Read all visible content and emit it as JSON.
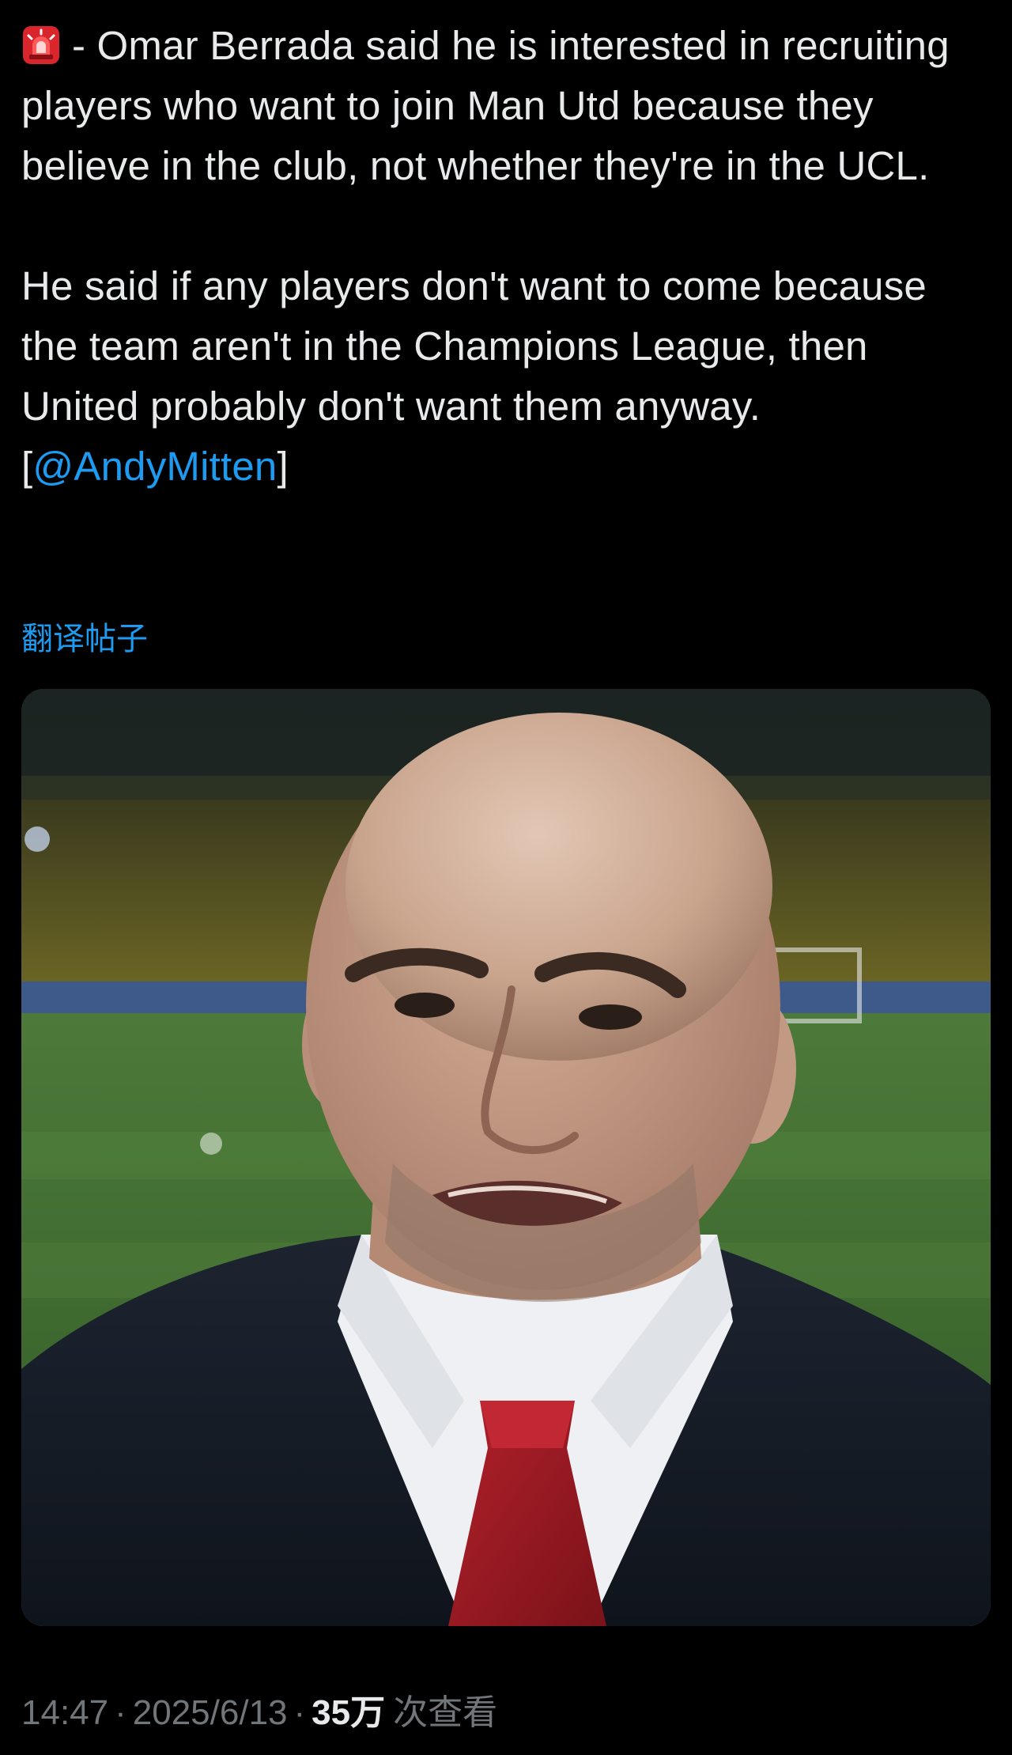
{
  "tweet": {
    "emoji_icon": "rotating-light-icon",
    "line1": "- Omar Berrada said he is interested in recruiting players who want to join Man Utd because they believe in the club, not whether they're in the UCL.",
    "line2_text": "He said if any players don't want to come because the team aren't in the Champions League, then United probably don't want them anyway. [",
    "mention": "@AndyMitten",
    "line2_close": "]",
    "translate_label": "翻译帖子"
  },
  "media": {
    "alt_icon": "photo-of-man-in-suit-at-stadium"
  },
  "meta": {
    "time": "14:47",
    "date": "2025/6/13",
    "views_count": "35万",
    "views_label": "次查看",
    "separator": "·"
  },
  "colors": {
    "background": "#000000",
    "text": "#e7e9ea",
    "link": "#1d9bf0",
    "secondary": "#71767b"
  }
}
